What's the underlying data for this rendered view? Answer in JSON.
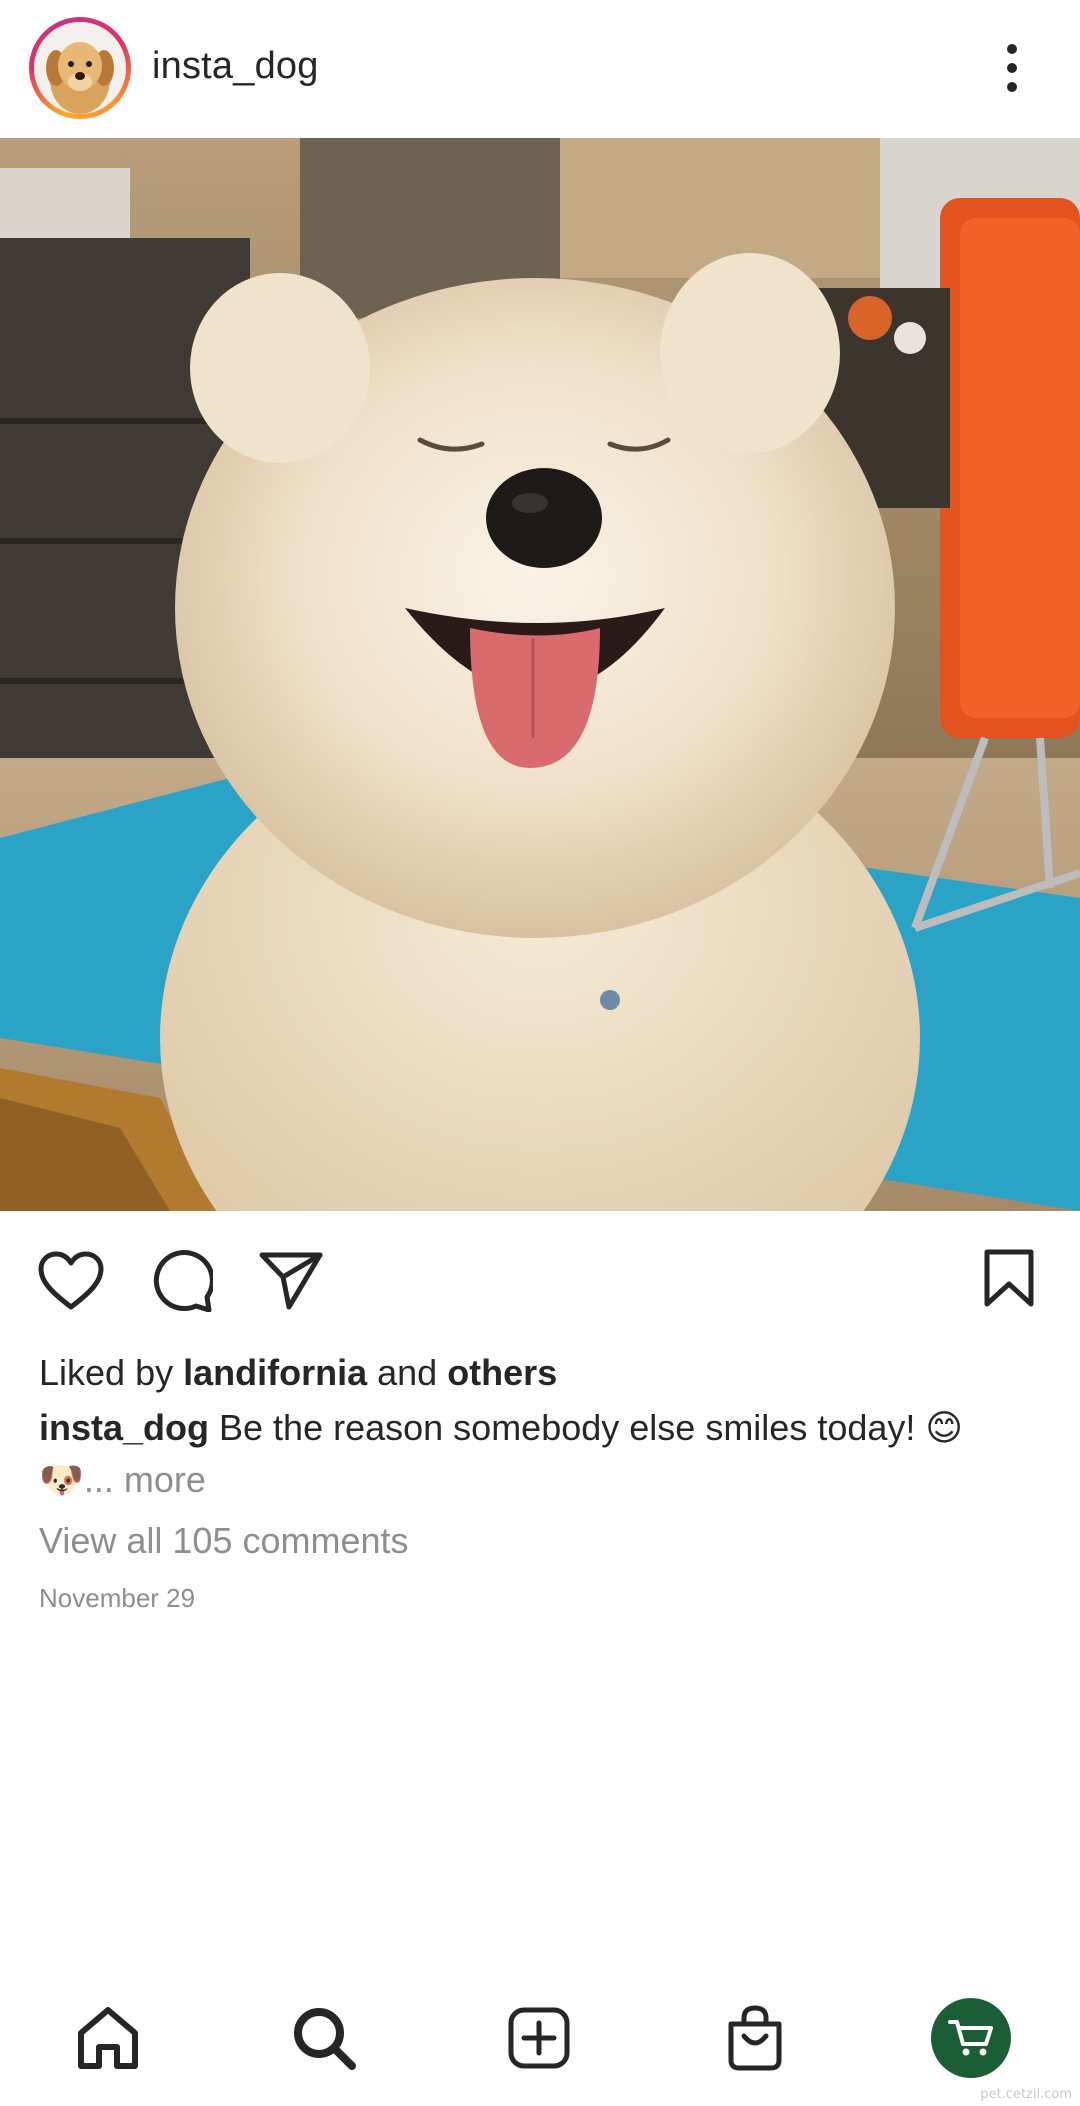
{
  "header": {
    "username": "insta_dog"
  },
  "post": {
    "liked_by_prefix": "Liked by ",
    "liked_by_user": "landifornia",
    "liked_by_conjunction": " and ",
    "liked_by_others": "others",
    "caption_user": "insta_dog",
    "caption_text": " Be the reason somebody else smiles today! 😊",
    "caption_emoji_line": "🐶",
    "caption_more": "... more",
    "view_comments": "View all 105 comments",
    "date": "November 29"
  },
  "icons": {
    "more": "more-vertical-icon",
    "like": "heart-icon",
    "comment": "comment-icon",
    "share": "paper-plane-icon",
    "save": "bookmark-icon",
    "home": "home-icon",
    "search": "search-icon",
    "create": "plus-square-icon",
    "shop": "shopping-bag-icon",
    "profile": "cart-icon"
  },
  "colors": {
    "text": "#262626",
    "secondary_text": "#8e8e8e",
    "profile_badge": "#1b5e35"
  },
  "watermark": "pet.cetzil.com"
}
